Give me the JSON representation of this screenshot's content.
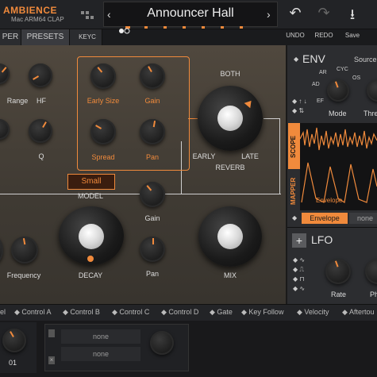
{
  "topbar": {
    "brand": "AMBIENCE",
    "sub": "Mac ARM64   CLAP",
    "preset_name": "Announcer Hall",
    "prev_arrow": "‹",
    "next_arrow": "›",
    "undo_label": "UNDO",
    "redo_label": "REDO",
    "save_label": "Save",
    "undo_icon": "↶",
    "redo_icon": "↷",
    "save_icon": "⭳"
  },
  "tabs": {
    "items": [
      {
        "label": "PER"
      },
      {
        "label": "PRESETS"
      }
    ],
    "keyc_label": "KEYC"
  },
  "main": {
    "labels": {
      "range": "Range",
      "hf": "HF",
      "q": "Q",
      "early_size": "Early Size",
      "gain_top": "Gain",
      "spread": "Spread",
      "pan_top": "Pan",
      "both": "BOTH",
      "early": "EARLY",
      "late": "LATE",
      "reverb": "REVERB",
      "model_value": "Small",
      "model": "MODEL",
      "gain_bottom": "Gain",
      "pan_bottom": "Pan",
      "decay": "DECAY",
      "mix": "MIX",
      "frequency": "Frequency"
    }
  },
  "right_panel": {
    "env_title": "ENV",
    "source_label": "Source",
    "modes": [
      "AR",
      "CYC",
      "AD",
      "OS",
      "EF"
    ],
    "mode_label": "Mode",
    "thresh_label": "Thre",
    "scope_tab": "SCOPE",
    "mapper_tab": "MAPPER",
    "envelope_text": "Envelope",
    "envelope_button": "Envelope",
    "none_button": "none",
    "lfo_title": "LFO",
    "rate_label": "Rate",
    "ph_label": "Ph"
  },
  "mod_row": {
    "items": [
      "el",
      "Control A",
      "Control B",
      "Control C",
      "Control D",
      "Gate",
      "Key Follow",
      "Velocity",
      "Aftertou"
    ]
  },
  "bottom": {
    "slot1_value": "01",
    "none1": "none",
    "none2": "none"
  },
  "colors": {
    "accent": "#f08a3c",
    "panel_bg": "#4a433a",
    "topbar_bg": "#222326"
  }
}
